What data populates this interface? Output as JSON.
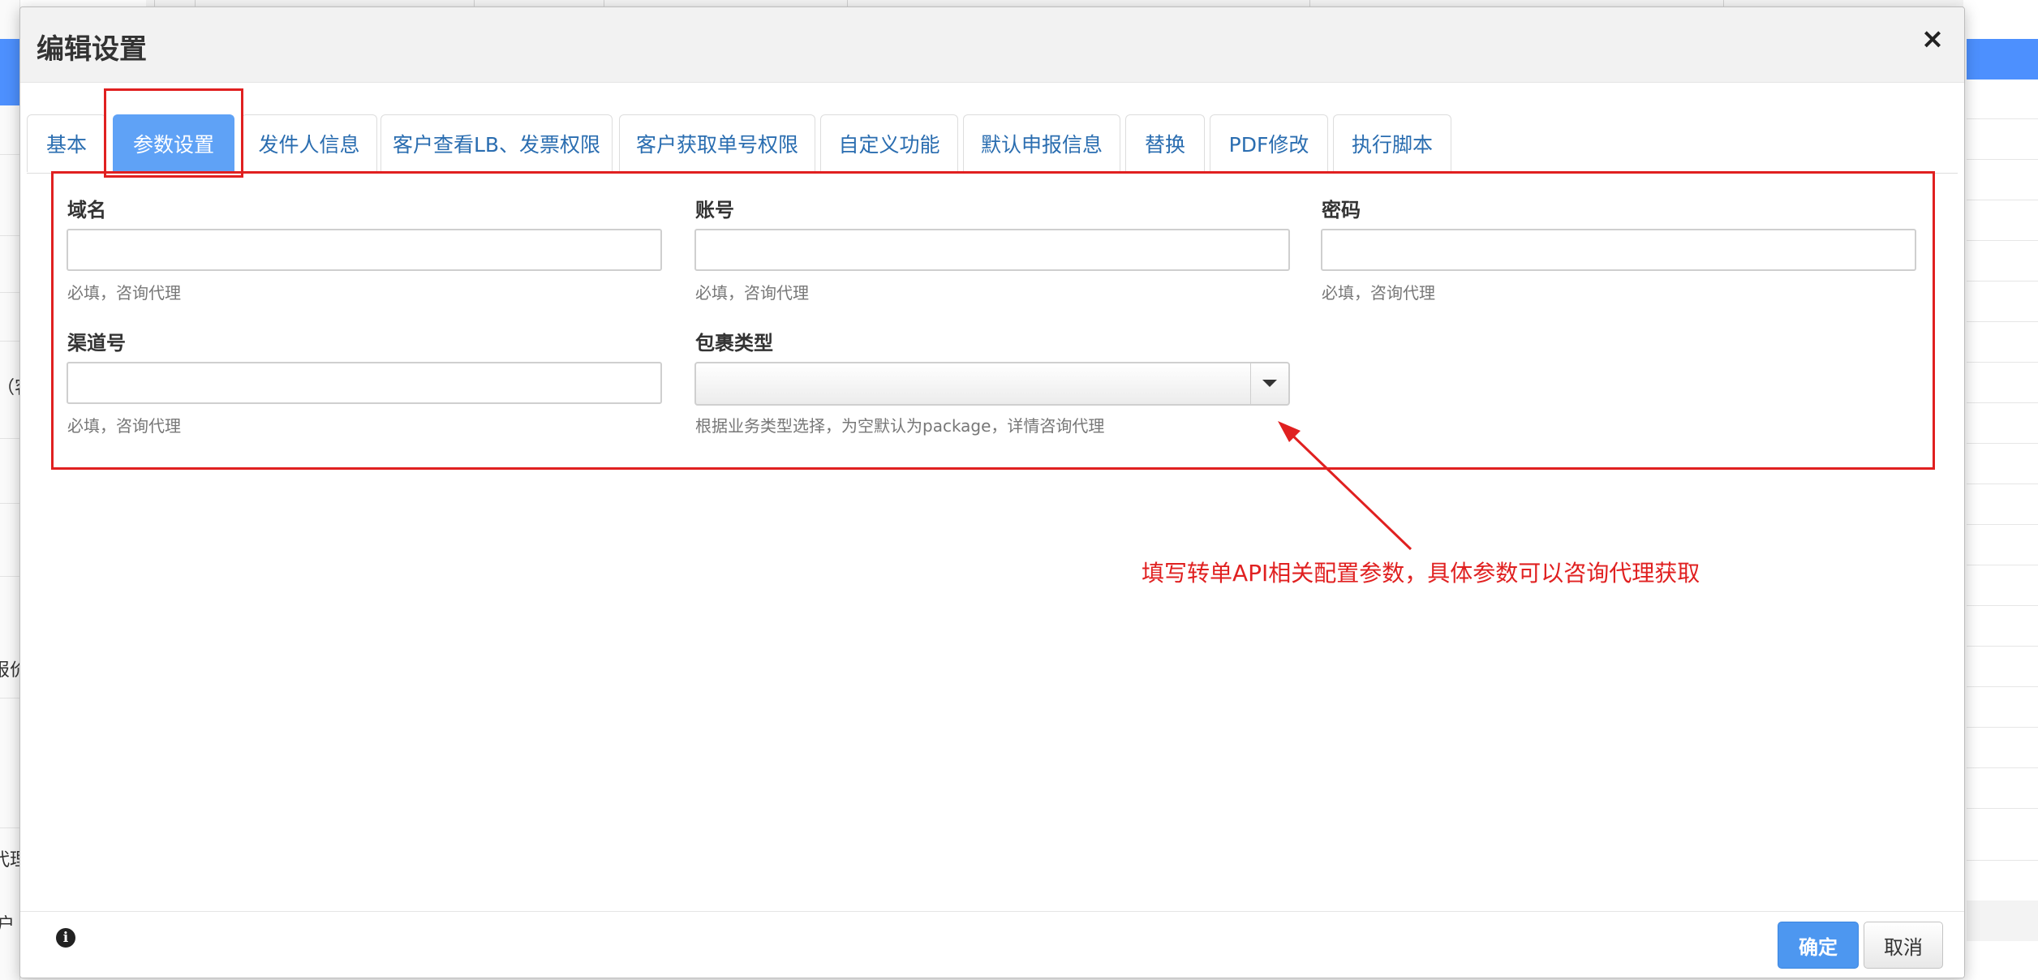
{
  "background": {
    "left_fragments": [
      "（客",
      "）",
      "报价",
      "代理",
      "户"
    ]
  },
  "dialog": {
    "title": "编辑设置",
    "close_glyph": "×"
  },
  "tabs": [
    {
      "label": "基本",
      "active": false
    },
    {
      "label": "参数设置",
      "active": true
    },
    {
      "label": "发件人信息",
      "active": false
    },
    {
      "label": "客户查看LB、发票权限",
      "active": false
    },
    {
      "label": "客户获取单号权限",
      "active": false
    },
    {
      "label": "自定义功能",
      "active": false
    },
    {
      "label": "默认申报信息",
      "active": false
    },
    {
      "label": "替换",
      "active": false
    },
    {
      "label": "PDF修改",
      "active": false
    },
    {
      "label": "执行脚本",
      "active": false
    }
  ],
  "form": {
    "domain": {
      "label": "域名",
      "value": "",
      "help": "必填，咨询代理"
    },
    "account": {
      "label": "账号",
      "value": "",
      "help": "必填，咨询代理"
    },
    "password": {
      "label": "密码",
      "value": "",
      "help": "必填，咨询代理"
    },
    "channel": {
      "label": "渠道号",
      "value": "",
      "help": "必填，咨询代理"
    },
    "package_type": {
      "label": "包裹类型",
      "selected": "",
      "help": "根据业务类型选择，为空默认为package，详情咨询代理"
    }
  },
  "annotation": {
    "text": "填写转单API相关配置参数，具体参数可以咨询代理获取",
    "color": "#e02020"
  },
  "footer": {
    "info_glyph": "i",
    "confirm_label": "确定",
    "cancel_label": "取消"
  },
  "colors": {
    "accent": "#4d97f0",
    "active_tab": "#5fa2f6",
    "link": "#2a6db0",
    "annotation": "#e02020"
  }
}
